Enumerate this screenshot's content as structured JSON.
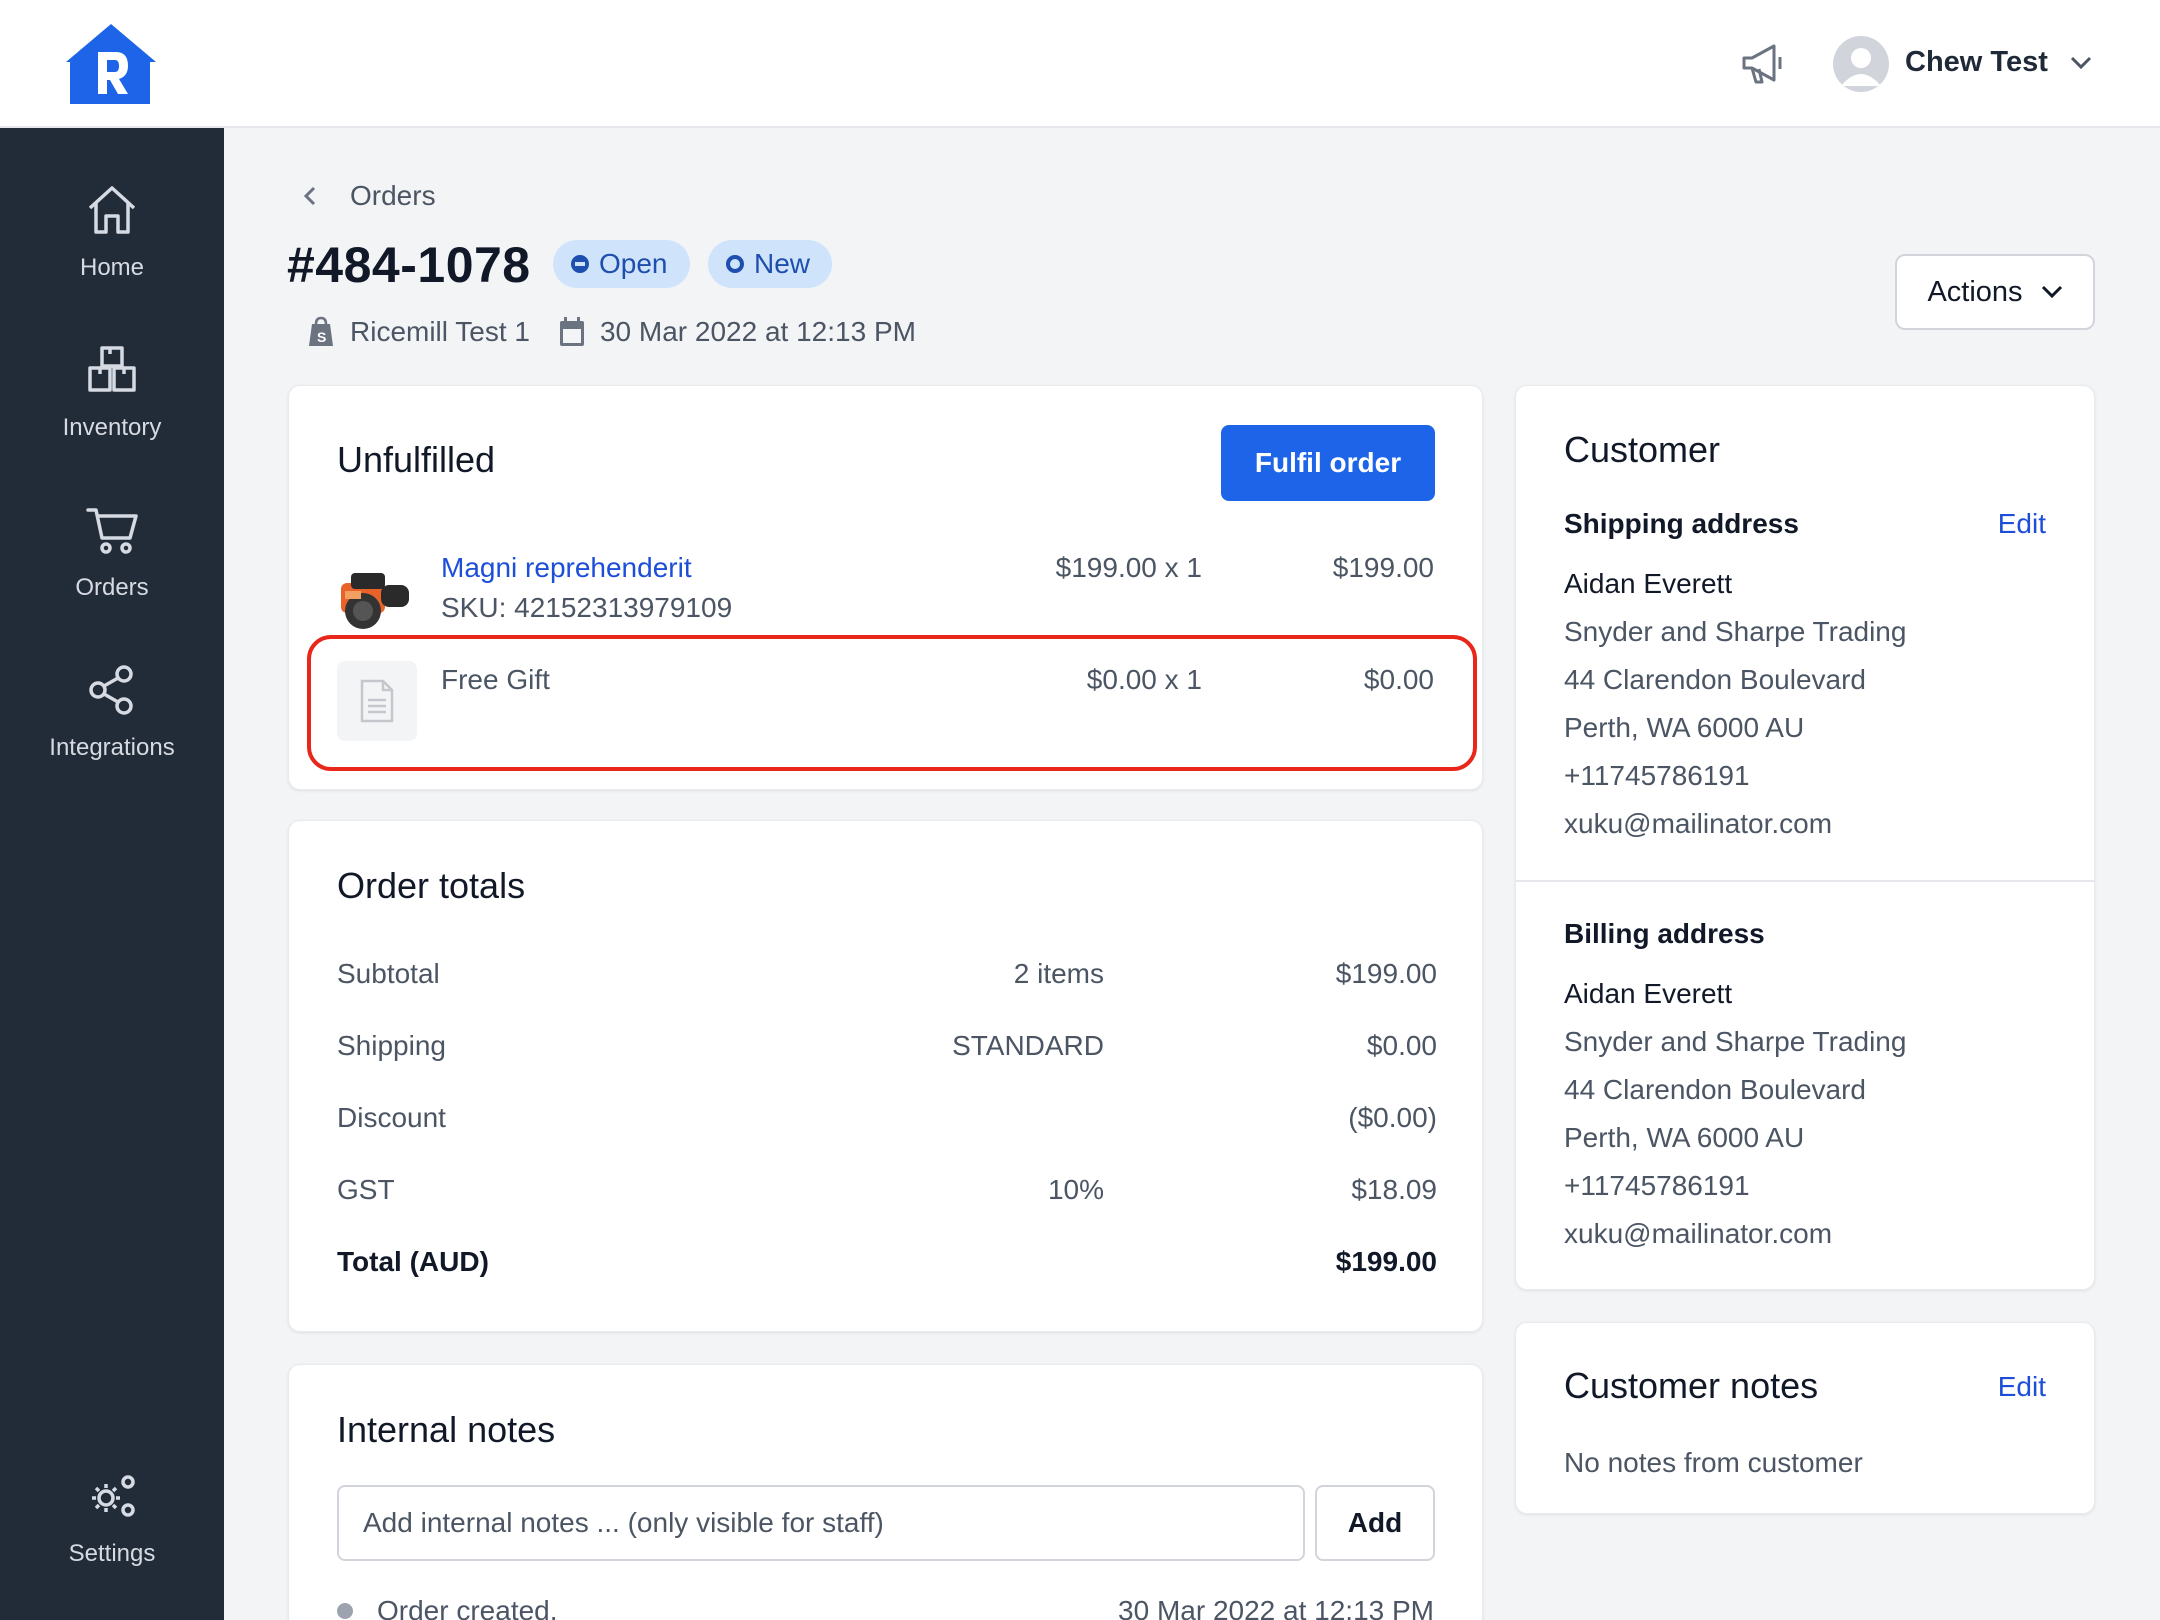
{
  "colors": {
    "brand": "#1d64e8",
    "sidebar": "#222b38",
    "badge_bg": "#cfe3fb",
    "badge_text": "#1e4fae",
    "link": "#1d4ed8",
    "highlight": "#e8261a"
  },
  "header": {
    "user_name": "Chew Test"
  },
  "sidebar": {
    "items": [
      {
        "label": "Home",
        "icon": "home-icon"
      },
      {
        "label": "Inventory",
        "icon": "boxes-icon"
      },
      {
        "label": "Orders",
        "icon": "cart-icon"
      },
      {
        "label": "Integrations",
        "icon": "share-icon"
      },
      {
        "label": "Settings",
        "icon": "cogs-icon"
      }
    ]
  },
  "order": {
    "breadcrumb": "Orders",
    "number": "#484-1078",
    "status_badges": [
      "Open",
      "New"
    ],
    "store": "Ricemill Test 1",
    "date": "30 Mar 2022 at 12:13 PM",
    "actions_label": "Actions"
  },
  "unfulfilled": {
    "title": "Unfulfilled",
    "fulfil_label": "Fulfil order",
    "items": [
      {
        "name": "Magni reprehenderit",
        "sku": "SKU: 42152313979109",
        "qty_price": "$199.00 x 1",
        "total": "$199.00"
      },
      {
        "name": "Free Gift",
        "qty_price": "$0.00 x 1",
        "total": "$0.00"
      }
    ]
  },
  "totals": {
    "title": "Order totals",
    "rows": [
      {
        "label": "Subtotal",
        "detail": "2 items",
        "amount": "$199.00"
      },
      {
        "label": "Shipping",
        "detail": "STANDARD",
        "amount": "$0.00"
      },
      {
        "label": "Discount",
        "detail": "",
        "amount": "($0.00)"
      },
      {
        "label": "GST",
        "detail": "10%",
        "amount": "$18.09"
      },
      {
        "label": "Total (AUD)",
        "detail": "",
        "amount": "$199.00"
      }
    ]
  },
  "internal_notes": {
    "title": "Internal notes",
    "placeholder": "Add internal notes ... (only visible for staff)",
    "add_label": "Add",
    "timeline": [
      {
        "text": "Order created.",
        "time": "30 Mar 2022 at 12:13 PM"
      }
    ]
  },
  "customer": {
    "title": "Customer",
    "edit_label": "Edit",
    "shipping": {
      "heading": "Shipping address",
      "lines": [
        "Aidan Everett",
        "Snyder and Sharpe Trading",
        "44 Clarendon Boulevard",
        "Perth, WA 6000 AU",
        "+11745786191",
        "xuku@mailinator.com"
      ]
    },
    "billing": {
      "heading": "Billing address",
      "lines": [
        "Aidan Everett",
        "Snyder and Sharpe Trading",
        "44 Clarendon Boulevard",
        "Perth, WA 6000 AU",
        "+11745786191",
        "xuku@mailinator.com"
      ]
    }
  },
  "customer_notes": {
    "title": "Customer notes",
    "edit_label": "Edit",
    "text": "No notes from customer"
  }
}
